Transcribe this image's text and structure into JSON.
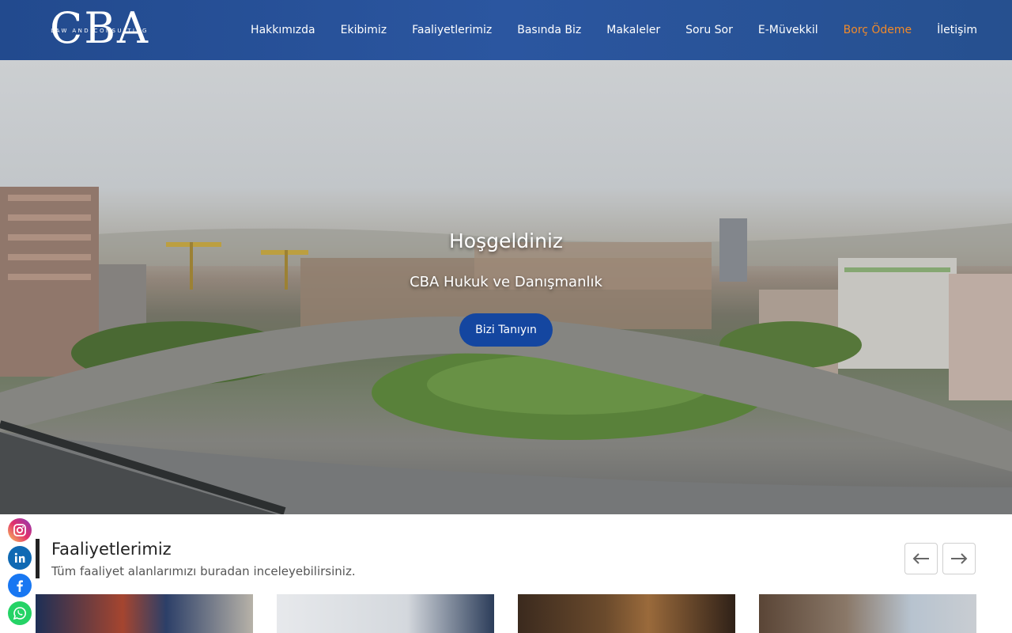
{
  "header": {
    "logo": {
      "letters": "CBA",
      "tagline": "LAW AND CONSULTING"
    },
    "nav": [
      {
        "label": "Hakkımızda"
      },
      {
        "label": "Ekibimiz"
      },
      {
        "label": "Faaliyetlerimiz"
      },
      {
        "label": "Basında Biz"
      },
      {
        "label": "Makaleler"
      },
      {
        "label": "Soru Sor"
      },
      {
        "label": "E-Müvekkil"
      },
      {
        "label": "Borç Ödeme",
        "active": true
      },
      {
        "label": "İletişim"
      }
    ],
    "colors": {
      "background": "#2b56a0",
      "active": "#f18a2a"
    }
  },
  "hero": {
    "title": "Hoşgeldiniz",
    "subtitle": "CBA Hukuk ve Danışmanlık",
    "button_label": "Bizi Tanıyın",
    "button_color": "#1446a0"
  },
  "activities": {
    "title": "Faaliyetlerimiz",
    "description": "Tüm faaliyet alanlarımızı buradan inceleyebilirsiniz.",
    "prev_icon": "arrow-left-icon",
    "next_icon": "arrow-right-icon"
  },
  "social": [
    "instagram-icon",
    "linkedin-icon",
    "facebook-icon",
    "whatsapp-icon"
  ]
}
